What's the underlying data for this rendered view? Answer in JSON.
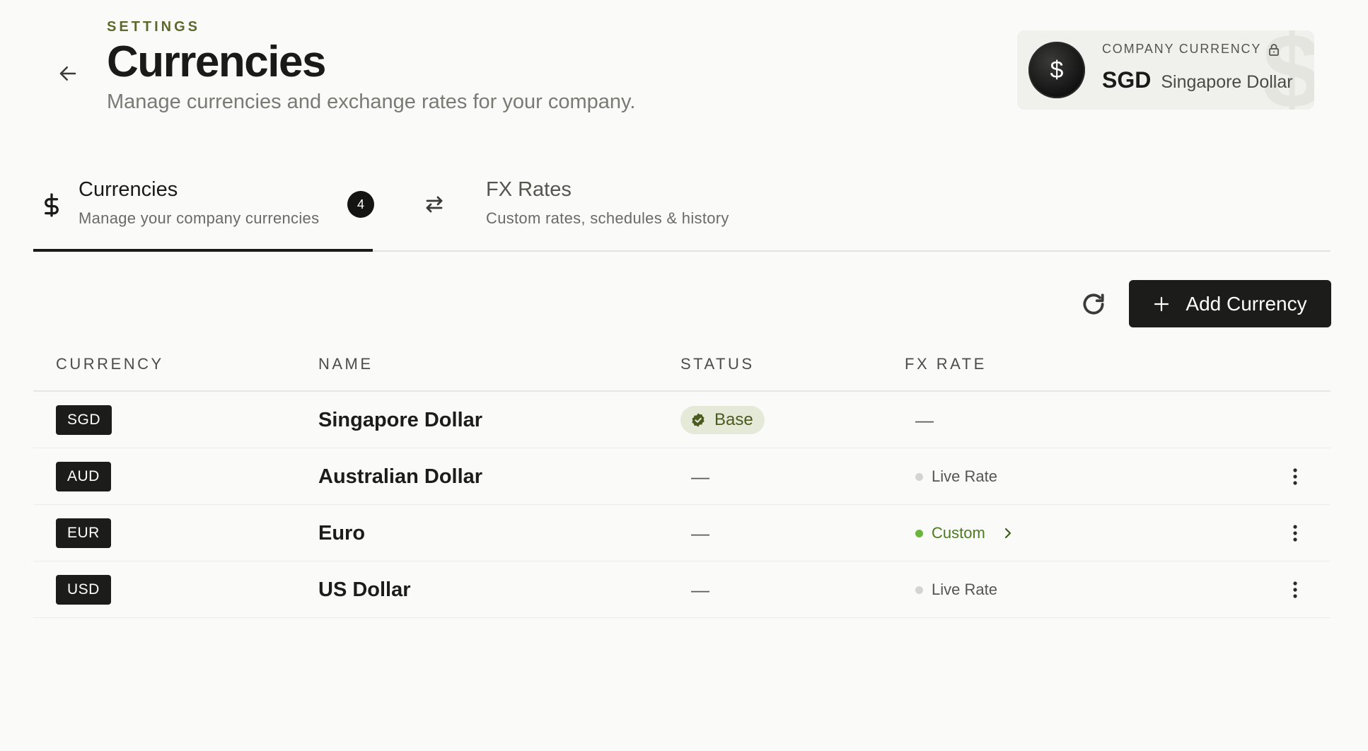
{
  "header": {
    "eyebrow": "SETTINGS",
    "title": "Currencies",
    "subtitle": "Manage currencies and exchange rates for your company."
  },
  "company_currency": {
    "label": "COMPANY CURRENCY",
    "code": "SGD",
    "name": "Singapore Dollar",
    "symbol": "$"
  },
  "tabs": [
    {
      "title": "Currencies",
      "description": "Manage your company currencies",
      "count": "4",
      "active": true,
      "icon": "dollar-icon"
    },
    {
      "title": "FX Rates",
      "description": "Custom rates, schedules & history",
      "active": false,
      "icon": "swap-arrows-icon"
    }
  ],
  "toolbar": {
    "add_label": "Add Currency",
    "refresh_icon": "refresh-icon"
  },
  "table": {
    "columns": [
      "CURRENCY",
      "NAME",
      "STATUS",
      "FX RATE"
    ],
    "rows": [
      {
        "code": "SGD",
        "name": "Singapore Dollar",
        "status": "Base",
        "fx": "—"
      },
      {
        "code": "AUD",
        "name": "Australian Dollar",
        "status": "—",
        "fx": "Live Rate"
      },
      {
        "code": "EUR",
        "name": "Euro",
        "status": "—",
        "fx": "Custom"
      },
      {
        "code": "USD",
        "name": "US Dollar",
        "status": "—",
        "fx": "Live Rate"
      }
    ]
  },
  "colors": {
    "primary": "#1c1c1a",
    "accent_green": "#4d7a21",
    "eyebrow": "#5b6a2c",
    "status_pill_bg": "#e4e9d8",
    "live_dot": "#d4d4d0",
    "custom_dot": "#6bb53e"
  }
}
